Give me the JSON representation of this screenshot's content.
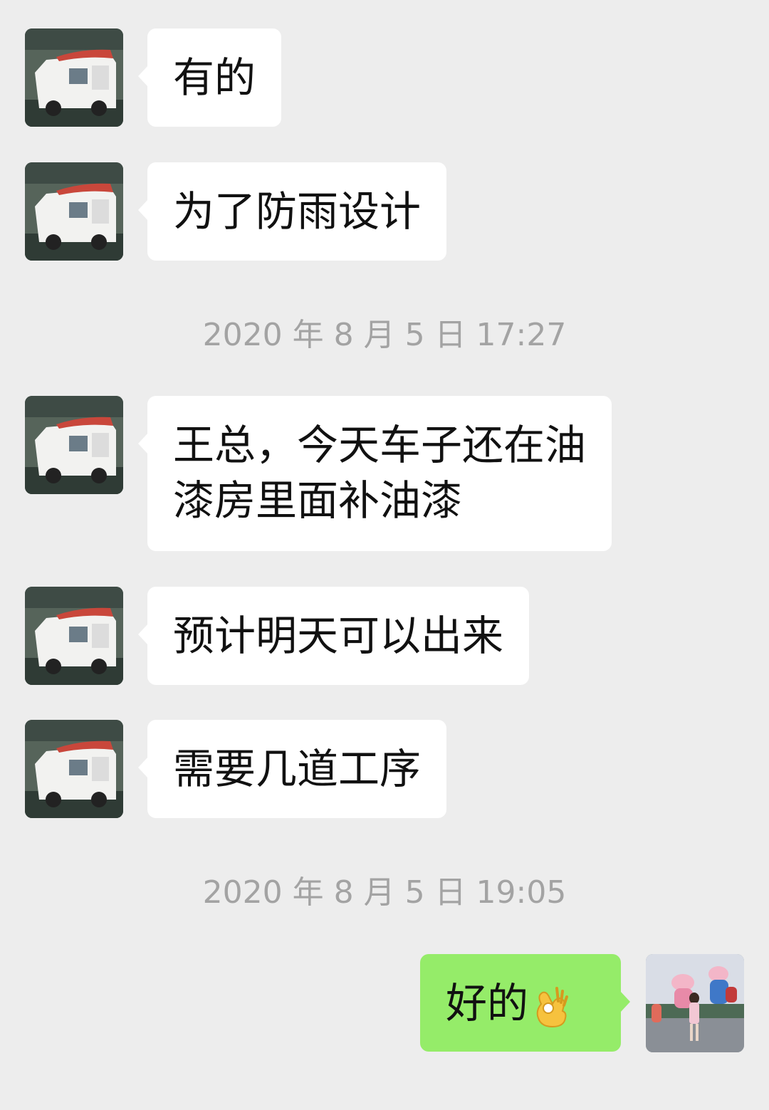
{
  "messages": [
    {
      "side": "left",
      "text": "有的"
    },
    {
      "side": "left",
      "text": "为了防雨设计"
    },
    {
      "type": "time",
      "text": "2020 年 8 月 5 日 17:27"
    },
    {
      "side": "left",
      "lines": [
        "王总，今天车子还在油",
        "漆房里面补油漆"
      ]
    },
    {
      "side": "left",
      "text": "预计明天可以出来"
    },
    {
      "side": "left",
      "text": "需要几道工序"
    },
    {
      "type": "time",
      "text": "2020 年 8 月 5 日 19:05"
    },
    {
      "side": "right",
      "text": "好的",
      "emoji": "ok-hand-emoji"
    }
  ],
  "colors": {
    "background": "#ededed",
    "incoming_bubble": "#ffffff",
    "outgoing_bubble": "#95ec69",
    "timestamp": "#a3a3a3"
  },
  "avatars": {
    "contact": "rv-photo-avatar",
    "self": "child-with-statues-avatar"
  }
}
